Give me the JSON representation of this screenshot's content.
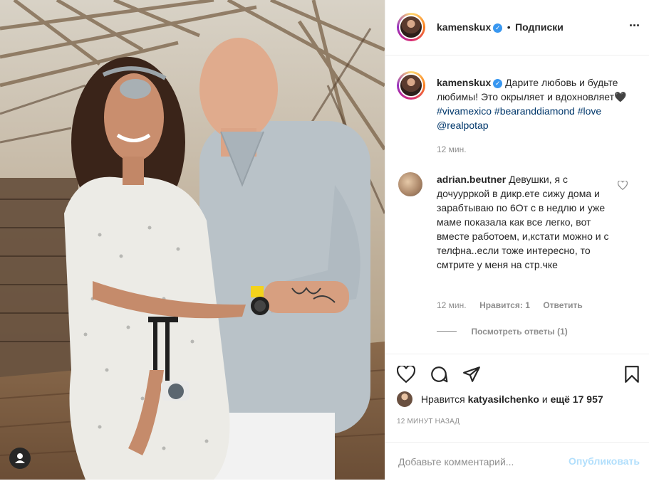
{
  "post": {
    "author": "kamenskux",
    "follow_state": "Подписки",
    "more_label": "···"
  },
  "caption": {
    "author": "kamenskux",
    "text": "Дарите любовь и будьте любимы! Это окрыляет и вдохновляет🖤",
    "hashtags": [
      "#vivamexico",
      "#bearanddiamond",
      "#love"
    ],
    "mention": "@realpotap",
    "time": "12 мин."
  },
  "comment": {
    "author": "adrian.beutner",
    "text": "Девушки, я с дочуурркой в дикр.ете сижу дома и зарабтываю по 6От с в недлю и уже маме показала как все легко, вот вместе работоем, и,кстати можно и с телфна..если тоже интересно, то смтрите у меня на стр.чке",
    "time": "12 мин.",
    "likes": "Нравится: 1",
    "reply": "Ответить",
    "view_replies": "Посмотреть ответы (1)"
  },
  "likes": {
    "prefix": "Нравится",
    "user": "katyasilchenko",
    "middle": "и",
    "count": "ещё 17 957"
  },
  "timestamp": "12 МИНУТ НАЗАД",
  "composer": {
    "placeholder": "Добавьте комментарий...",
    "publish": "Опубликовать"
  },
  "colors": {
    "accent": "#0095f6",
    "publish_disabled": "#b2dffc",
    "verified": "#3897f0",
    "hashtag": "#00376b"
  },
  "icons": [
    "heart-icon",
    "comment-icon",
    "share-icon",
    "bookmark-icon",
    "user-tag-icon",
    "verified-icon",
    "comment-like-icon"
  ]
}
